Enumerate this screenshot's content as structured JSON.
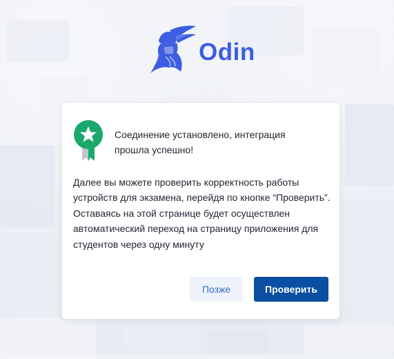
{
  "brand": {
    "name": "Odin",
    "color": "#3d5ee0"
  },
  "dialog": {
    "success_message": "Соединение установлено, интеграция прошла успешно!",
    "paragraph_1": "Далее вы можете проверить корректность работы устройств для экзамена, перейдя по кнопке “Проверить”.",
    "paragraph_2": "Оставаясь на этой странице будет осуществлен автоматический переход на страницу приложения для студентов через одну минуту",
    "badge_icon": "success-ribbon-icon",
    "badge_color": "#1aa86b"
  },
  "actions": {
    "later_label": "Позже",
    "check_label": "Проверить",
    "primary_color": "#0b4ea2"
  }
}
